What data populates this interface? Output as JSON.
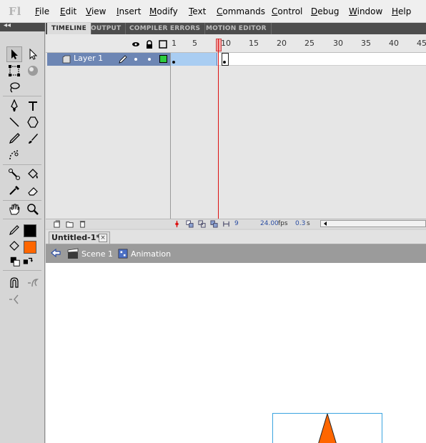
{
  "app": {
    "logo": "Fl"
  },
  "menu": [
    {
      "label": "File",
      "u": "F",
      "rest": "ile"
    },
    {
      "label": "Edit",
      "u": "E",
      "rest": "dit"
    },
    {
      "label": "View",
      "u": "V",
      "rest": "iew"
    },
    {
      "label": "Insert",
      "u": "I",
      "rest": "nsert"
    },
    {
      "label": "Modify",
      "u": "M",
      "rest": "odify"
    },
    {
      "label": "Text",
      "u": "T",
      "rest": "ext"
    },
    {
      "label": "Commands",
      "u": "C",
      "rest": "ommands"
    },
    {
      "label": "Control",
      "u": "C",
      "rest": "ontrol"
    },
    {
      "label": "Debug",
      "u": "D",
      "rest": "ebug"
    },
    {
      "label": "Window",
      "u": "W",
      "rest": "indow"
    },
    {
      "label": "Help",
      "u": "H",
      "rest": "elp"
    }
  ],
  "toolbar": {
    "collapse": "◂◂",
    "tools": [
      "selection-tool",
      "subselection-tool",
      "free-transform-tool",
      "3d-rotation-tool",
      "lasso-tool",
      "pen-tool",
      "text-tool",
      "line-tool",
      "polystar-tool",
      "pencil-tool",
      "brush-tool",
      "deco-tool",
      "bone-tool",
      "paint-bucket-tool",
      "eyedropper-tool",
      "eraser-tool",
      "hand-tool",
      "zoom-tool",
      "stroke-color-tool",
      "fill-color-tool",
      "black-white-tool",
      "swap-colors-tool",
      "snap-to-objects-tool",
      "smooth-tool",
      "straighten-tool"
    ],
    "stroke_color": "#000000",
    "fill_color": "#ff6600"
  },
  "timeline": {
    "tabs": [
      "TIMELINE",
      "OUTPUT",
      "COMPILER ERRORS",
      "MOTION EDITOR"
    ],
    "active_tab": "TIMELINE",
    "ruler": [
      "1",
      "5",
      "10",
      "15",
      "20",
      "25",
      "30",
      "35",
      "40",
      "45"
    ],
    "layer": {
      "name": "Layer 1"
    },
    "current_frame": "9",
    "fps": "24.00",
    "fps_unit": "fps",
    "time": "0.3",
    "time_unit": "s"
  },
  "document": {
    "tab_title": "Untitled-1*",
    "close": "×",
    "scene": "Scene 1",
    "symbol": "Animation"
  },
  "colors": {
    "selection": "#6d86b4",
    "frames_selected": "#a9cdf2",
    "playhead": "#d11111",
    "stage_outline": "#3aa4e0",
    "shape_fill": "#ff6600"
  }
}
